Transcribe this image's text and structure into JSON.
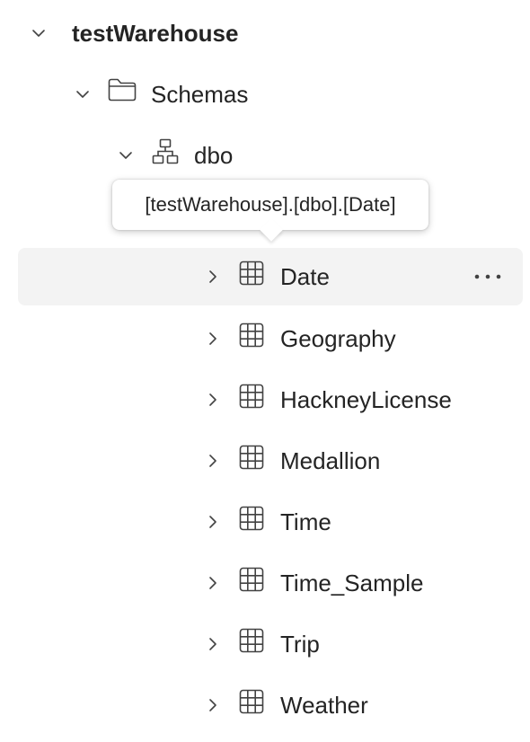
{
  "tree": {
    "root": {
      "label": "testWarehouse",
      "expanded": true
    },
    "schemas": {
      "label": "Schemas",
      "expanded": true
    },
    "schema": {
      "label": "dbo",
      "expanded": true
    },
    "tooltip": {
      "text": "[testWarehouse].[dbo].[Date]"
    },
    "tables": [
      {
        "label": "Date",
        "selected": true
      },
      {
        "label": "Geography"
      },
      {
        "label": "HackneyLicense"
      },
      {
        "label": "Medallion"
      },
      {
        "label": "Time"
      },
      {
        "label": "Time_Sample"
      },
      {
        "label": "Trip"
      },
      {
        "label": "Weather"
      }
    ],
    "icons": {
      "expanded": "chevron-down-icon",
      "collapsed": "chevron-right-icon",
      "folder": "folder-icon",
      "schema": "schema-icon",
      "table": "table-icon",
      "more": "more-options-icon"
    }
  }
}
